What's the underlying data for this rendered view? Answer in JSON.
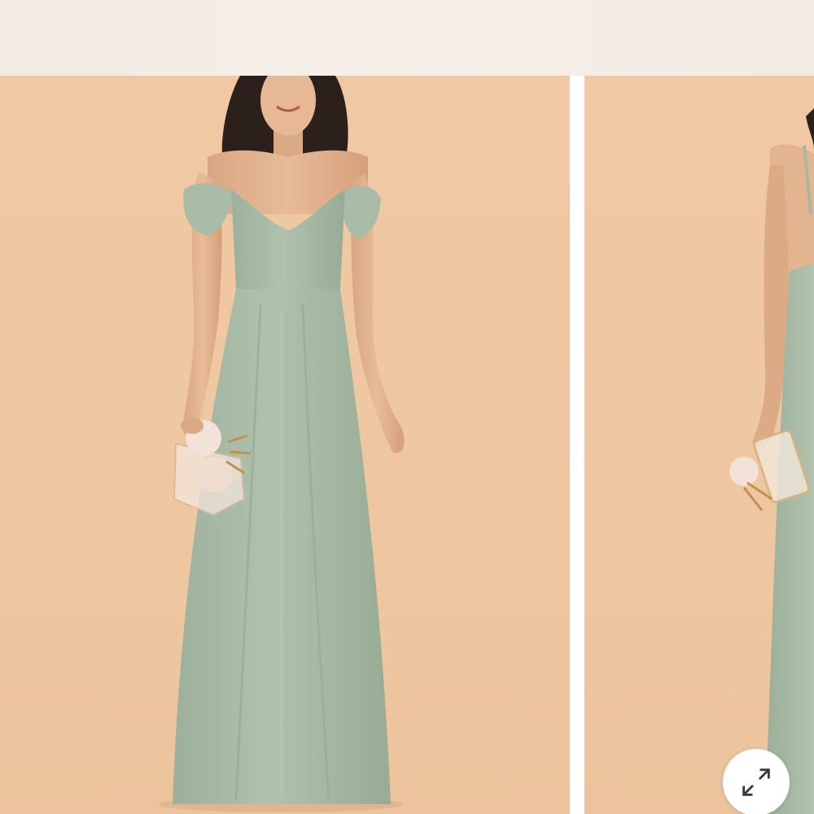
{
  "gallery": {
    "slides": [
      {
        "image": "product-photo-front"
      },
      {
        "image": "product-photo-side"
      }
    ],
    "expand_icon": "expand-arrows-icon"
  },
  "colors": {
    "backdrop": "#efc7a2",
    "dress": "#a9bba6",
    "dress_shadow": "#94a891",
    "skin": "#e2b48f",
    "hair": "#2b201b",
    "top_bar": "#f4ece5",
    "button_bg": "#ffffff",
    "icon_stroke": "#3a3a3a"
  }
}
